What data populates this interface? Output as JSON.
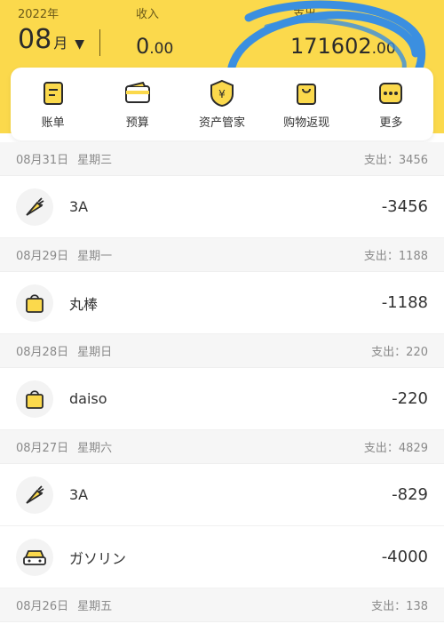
{
  "header": {
    "year": "2022年",
    "month_num": "08",
    "month_unit": "月",
    "month_caret": "▼",
    "income_label": "收入",
    "income_int": "0",
    "income_dec": ".00",
    "expense_label": "支出",
    "expense_int": "171602",
    "expense_dec": ".00"
  },
  "nav": [
    {
      "label": "账单",
      "icon": "bill-icon"
    },
    {
      "label": "预算",
      "icon": "budget-wallet-icon"
    },
    {
      "label": "资产管家",
      "icon": "asset-shield-icon"
    },
    {
      "label": "购物返现",
      "icon": "shopping-bag-icon"
    },
    {
      "label": "更多",
      "icon": "more-icon"
    }
  ],
  "days": [
    {
      "date": "08月31日",
      "weekday": "星期三",
      "total": "支出：3456",
      "items": [
        {
          "title": "3A",
          "amount": "-3456",
          "icon": "carrot-icon"
        }
      ]
    },
    {
      "date": "08月29日",
      "weekday": "星期一",
      "total": "支出：1188",
      "items": [
        {
          "title": "丸棒",
          "amount": "-1188",
          "icon": "shopping-bag-icon"
        }
      ]
    },
    {
      "date": "08月28日",
      "weekday": "星期日",
      "total": "支出：220",
      "items": [
        {
          "title": "daiso",
          "amount": "-220",
          "icon": "shopping-bag-icon"
        }
      ]
    },
    {
      "date": "08月27日",
      "weekday": "星期六",
      "total": "支出：4829",
      "items": [
        {
          "title": "3A",
          "amount": "-829",
          "icon": "carrot-icon"
        },
        {
          "title": "ガソリン",
          "amount": "-4000",
          "icon": "car-icon"
        }
      ]
    },
    {
      "date": "08月26日",
      "weekday": "星期五",
      "total": "支出：138",
      "items": []
    }
  ],
  "colors": {
    "accent": "#fbd94c",
    "scribble": "#3b8fe0"
  }
}
